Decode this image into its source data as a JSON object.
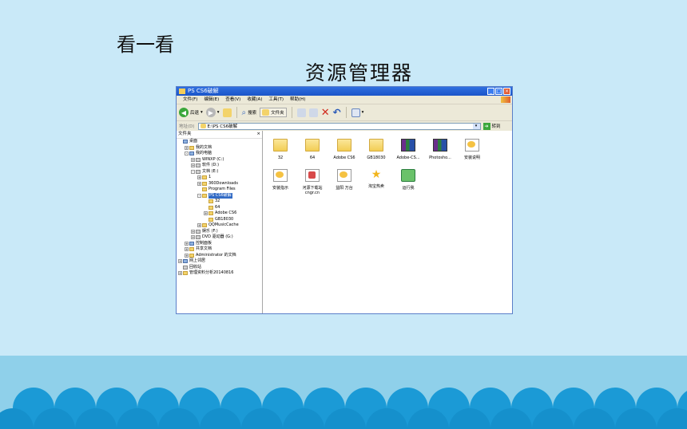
{
  "slide": {
    "title": "看一看",
    "caption": "资源管理器"
  },
  "window": {
    "title": "PS CS6破解",
    "menu": [
      "文件(F)",
      "编辑(E)",
      "查看(V)",
      "收藏(A)",
      "工具(T)",
      "帮助(H)"
    ],
    "toolbar": {
      "back": "后退",
      "search": "搜索",
      "folders": "文件夹"
    },
    "address": {
      "label": "地址(D)",
      "value": "E:\\PS CS6破解",
      "go": "转到"
    },
    "tree": {
      "header": "文件夹",
      "close": "×",
      "items": [
        {
          "label": "桌面",
          "toggle": "",
          "kind": "pc"
        },
        {
          "label": "我的文档",
          "toggle": "+",
          "kind": "folder"
        },
        {
          "label": "我的电脑",
          "toggle": "-",
          "kind": "pc"
        },
        {
          "label": "WINXP (C:)",
          "toggle": "+",
          "kind": "drive"
        },
        {
          "label": "软件 (D:)",
          "toggle": "+",
          "kind": "drive"
        },
        {
          "label": "文档 (E:)",
          "toggle": "-",
          "kind": "drive"
        },
        {
          "label": "1",
          "toggle": "+",
          "kind": "folder"
        },
        {
          "label": "360Downloads",
          "toggle": "+",
          "kind": "folder"
        },
        {
          "label": "Program Files",
          "toggle": "",
          "kind": "folder"
        },
        {
          "label": "PS CS6破解",
          "toggle": "-",
          "kind": "folder",
          "selected": true
        },
        {
          "label": "32",
          "toggle": "",
          "kind": "folder"
        },
        {
          "label": "64",
          "toggle": "",
          "kind": "folder"
        },
        {
          "label": "Adobe CS6",
          "toggle": "+",
          "kind": "folder"
        },
        {
          "label": "GB18030",
          "toggle": "",
          "kind": "folder"
        },
        {
          "label": "QQMusicCache",
          "toggle": "+",
          "kind": "folder"
        },
        {
          "label": "娱乐 (F:)",
          "toggle": "+",
          "kind": "drive"
        },
        {
          "label": "DVD 驱动器 (G:)",
          "toggle": "+",
          "kind": "drive"
        },
        {
          "label": "控制面板",
          "toggle": "+",
          "kind": "pc"
        },
        {
          "label": "共享文档",
          "toggle": "+",
          "kind": "folder"
        },
        {
          "label": "Administrator 的文档",
          "toggle": "+",
          "kind": "folder"
        },
        {
          "label": "网上邻居",
          "toggle": "+",
          "kind": "pc"
        },
        {
          "label": "回收站",
          "toggle": "",
          "kind": "drive"
        },
        {
          "label": "管理资料分析20140816",
          "toggle": "+",
          "kind": "folder"
        }
      ]
    },
    "files": [
      {
        "name": "32",
        "icon": "folder"
      },
      {
        "name": "64",
        "icon": "folder"
      },
      {
        "name": "Adobe CS6",
        "icon": "folder"
      },
      {
        "name": "GB18030",
        "icon": "folder"
      },
      {
        "name": "Adobe-CS...",
        "icon": "rar"
      },
      {
        "name": "Photosho...",
        "icon": "rar"
      },
      {
        "name": "安装说明",
        "icon": "doc"
      },
      {
        "name": "安装指示",
        "icon": "doc"
      },
      {
        "name": "河源下载站 cngr.cn",
        "icon": "pen"
      },
      {
        "name": "益阳 万台",
        "icon": "doc"
      },
      {
        "name": "淘宝热卖",
        "icon": "star"
      },
      {
        "name": "运行我",
        "icon": "app"
      }
    ]
  }
}
